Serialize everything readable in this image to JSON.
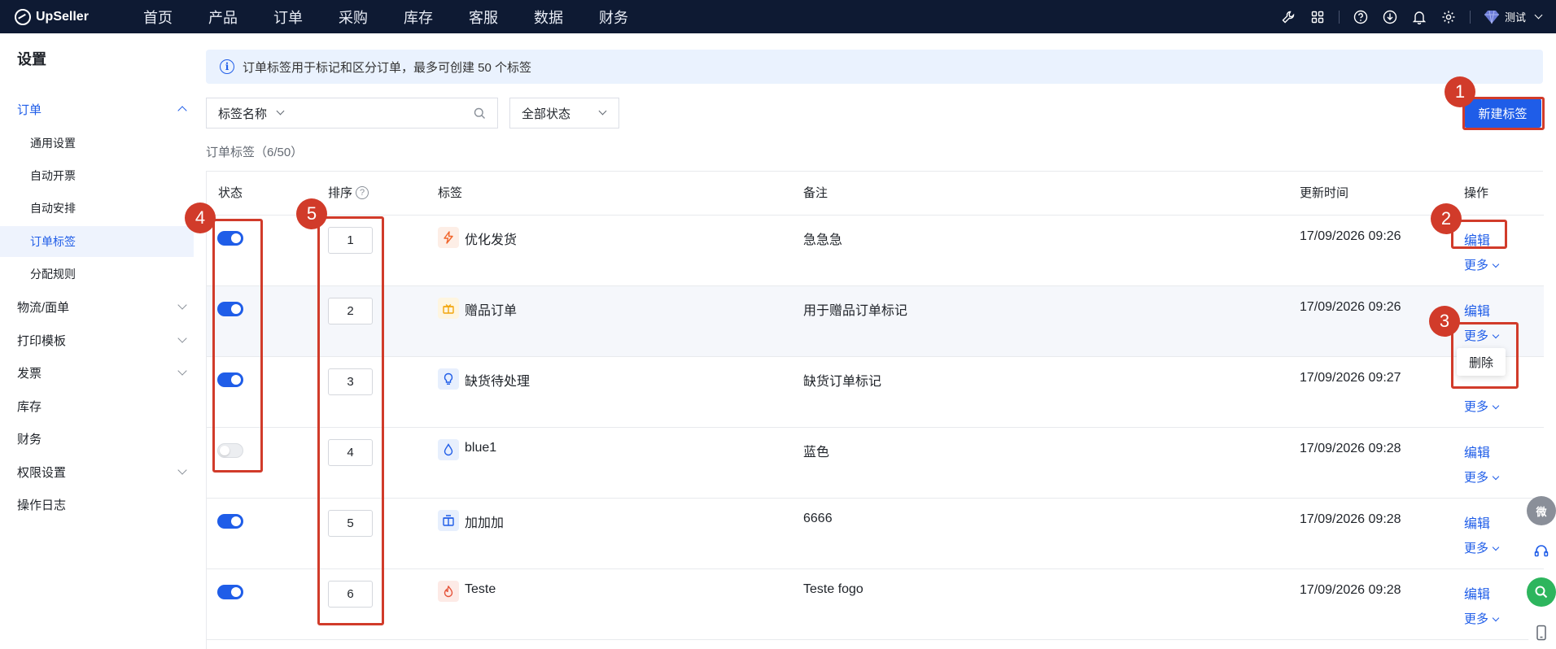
{
  "app": {
    "brand": "UpSeller"
  },
  "nav": {
    "items": [
      "首页",
      "产品",
      "订单",
      "采购",
      "库存",
      "客服",
      "数据",
      "财务"
    ]
  },
  "user": {
    "name": "测试"
  },
  "sidebar": {
    "title": "设置",
    "items": [
      {
        "label": "订单",
        "kind": "parent",
        "state": "open"
      },
      {
        "label": "通用设置",
        "kind": "sub"
      },
      {
        "label": "自动开票",
        "kind": "sub"
      },
      {
        "label": "自动安排",
        "kind": "sub"
      },
      {
        "label": "订单标签",
        "kind": "sub",
        "state": "active"
      },
      {
        "label": "分配规则",
        "kind": "sub"
      },
      {
        "label": "物流/面单",
        "kind": "parent"
      },
      {
        "label": "打印模板",
        "kind": "parent"
      },
      {
        "label": "发票",
        "kind": "parent"
      },
      {
        "label": "库存",
        "kind": "item"
      },
      {
        "label": "财务",
        "kind": "item"
      },
      {
        "label": "权限设置",
        "kind": "parent"
      },
      {
        "label": "操作日志",
        "kind": "item"
      }
    ]
  },
  "info": {
    "text": "订单标签用于标记和区分订单，最多可创建 50 个标签"
  },
  "filters": {
    "field_select": "标签名称",
    "search_placeholder": "",
    "status_select": "全部状态"
  },
  "new_button": "新建标签",
  "count_label": "订单标签（6/50）",
  "table": {
    "headers": {
      "status": "状态",
      "order": "排序",
      "tag": "标签",
      "note": "备注",
      "updated": "更新时间",
      "actions": "操作"
    },
    "edit_label": "编辑",
    "more_label": "更多",
    "rows": [
      {
        "enabled": true,
        "order": "1",
        "tag": "优化发货",
        "icon": "lightning-icon",
        "icon_color": "#f0642a",
        "icon_bg": "#fdeee6",
        "note": "急急急",
        "updated": "17/09/2026 09:26"
      },
      {
        "enabled": true,
        "order": "2",
        "tag": "赠品订单",
        "icon": "gift-icon",
        "icon_color": "#f2a50c",
        "icon_bg": "#fef5e0",
        "note": "用于赠品订单标记",
        "updated": "17/09/2026 09:26"
      },
      {
        "enabled": true,
        "order": "3",
        "tag": "缺货待处理",
        "icon": "bulb-icon",
        "icon_color": "#1f5de8",
        "icon_bg": "#e7effd",
        "note": "缺货订单标记",
        "updated": "17/09/2026 09:27"
      },
      {
        "enabled": false,
        "order": "4",
        "tag": "blue1",
        "icon": "drop-icon",
        "icon_color": "#1f5de8",
        "icon_bg": "#e7effd",
        "note": "蓝色",
        "updated": "17/09/2026 09:28"
      },
      {
        "enabled": true,
        "order": "5",
        "tag": "加加加",
        "icon": "box-icon",
        "icon_color": "#1f5de8",
        "icon_bg": "#e7effd",
        "note": "6666",
        "updated": "17/09/2026 09:28"
      },
      {
        "enabled": true,
        "order": "6",
        "tag": "Teste",
        "icon": "fire-icon",
        "icon_color": "#e5533a",
        "icon_bg": "#fdeae6",
        "note": "Teste fogo",
        "updated": "17/09/2026 09:28"
      }
    ]
  },
  "more_dropdown": {
    "delete_label": "删除"
  },
  "annotations": [
    "1",
    "2",
    "3",
    "4",
    "5"
  ],
  "float": {
    "wechat_label": "微"
  },
  "colors": {
    "primary": "#1f5de8",
    "topbar": "#0e1a33",
    "annotation": "#d13b2a"
  }
}
